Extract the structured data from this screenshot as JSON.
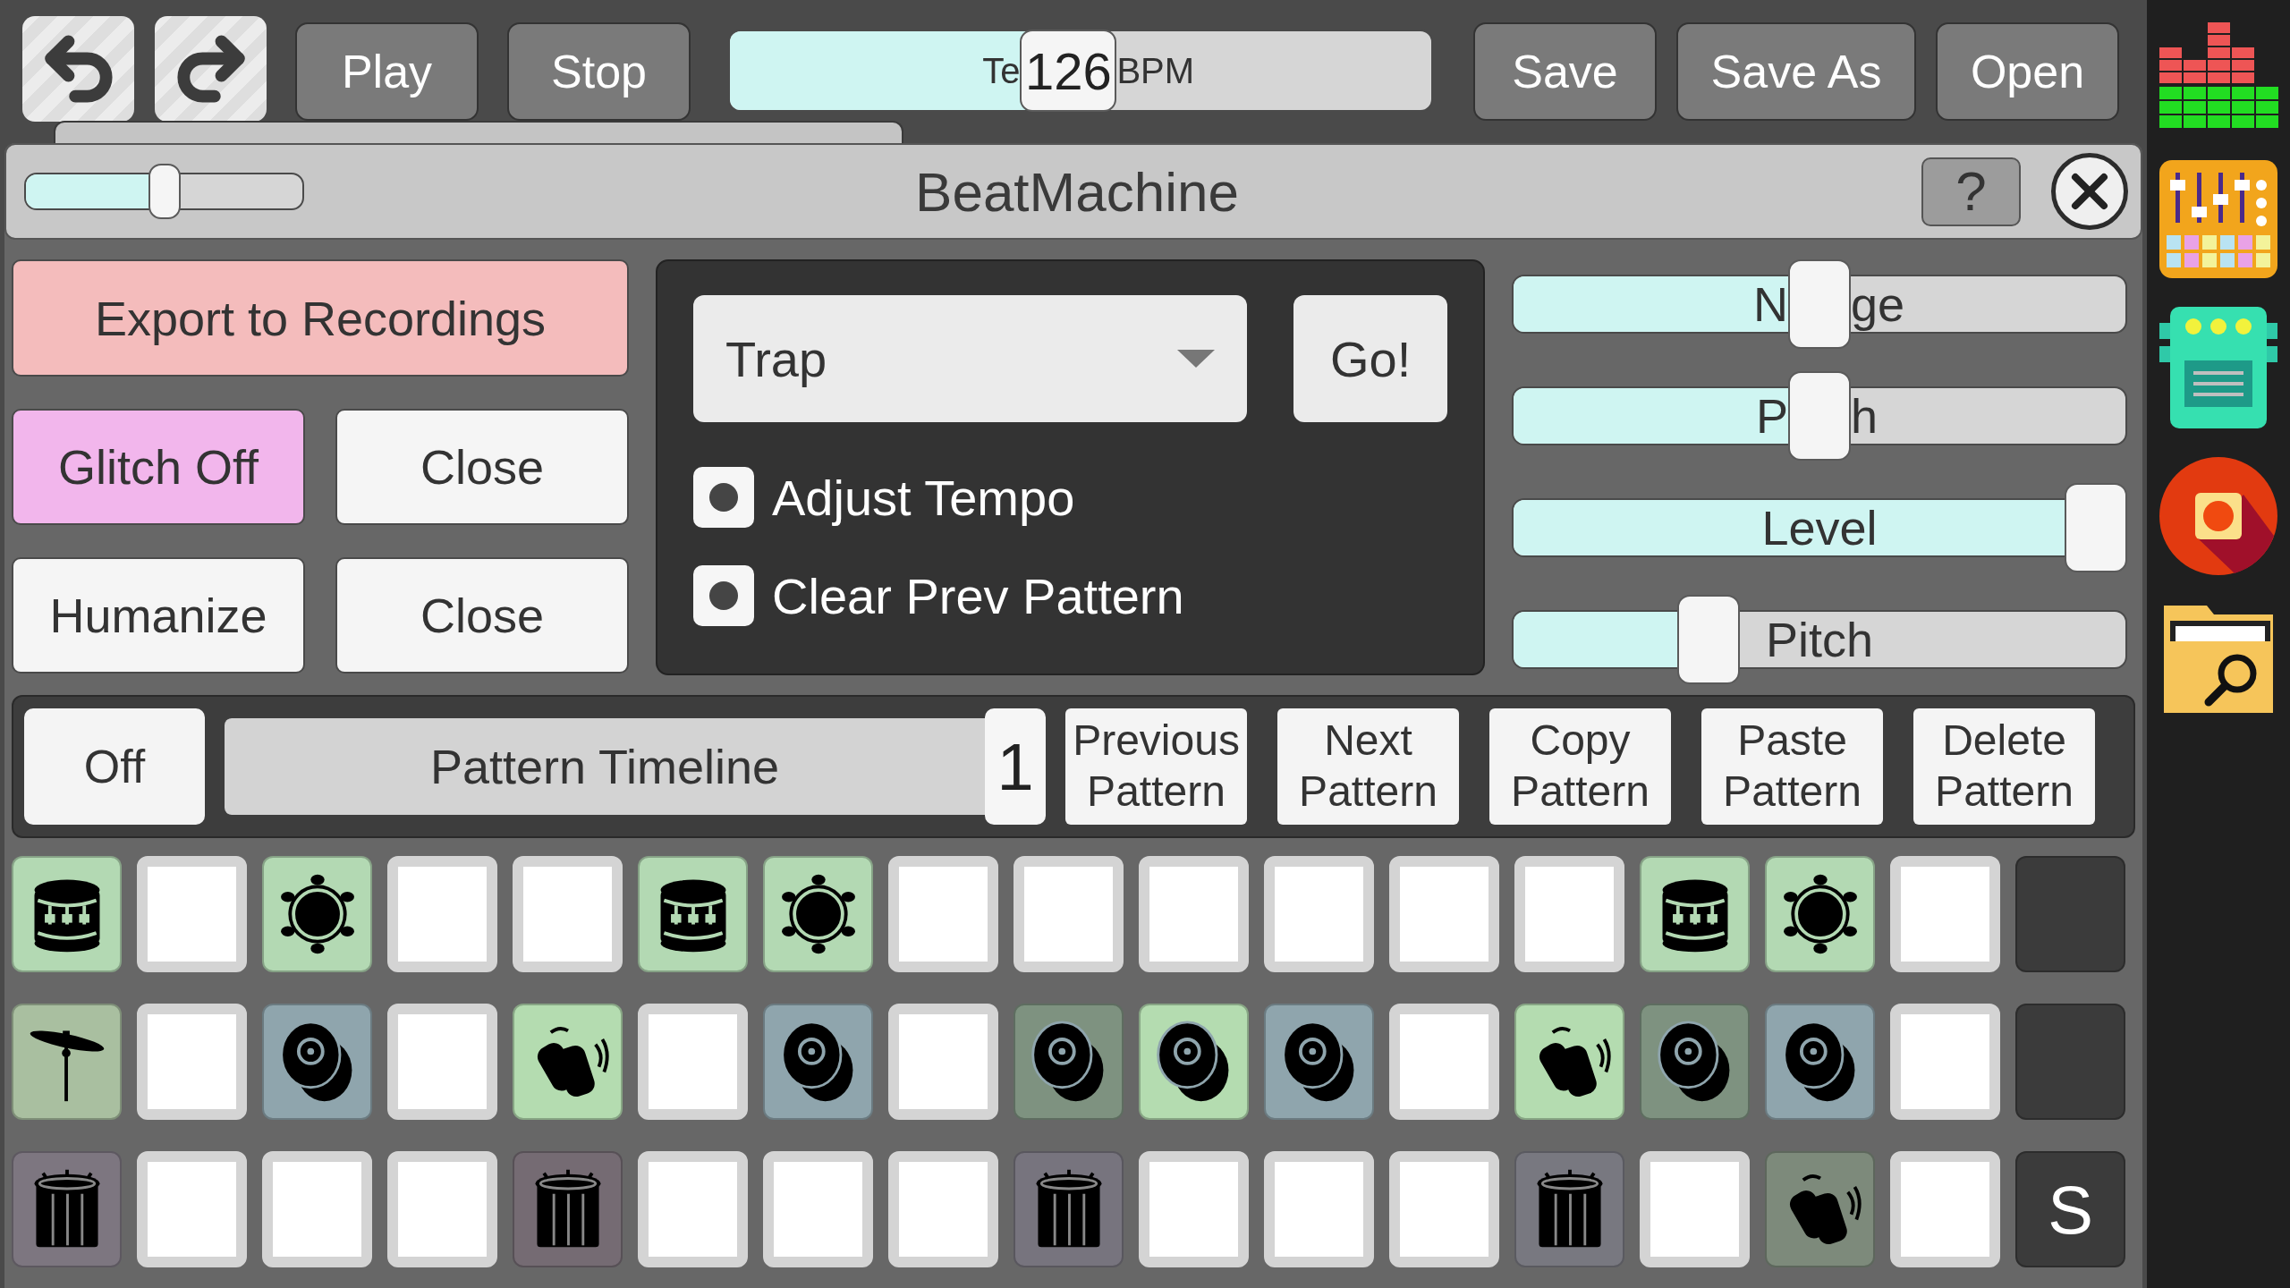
{
  "history_buttons": [
    {
      "kind": "undo"
    },
    {
      "kind": "redo"
    }
  ],
  "transport_buttons": [
    "Play",
    "Stop"
  ],
  "tempo": {
    "label_parts": [
      "Te",
      "BPM"
    ],
    "value": "126",
    "level": 0.48
  },
  "file_buttons": [
    "Save",
    "Save As",
    "Open"
  ],
  "dock": [
    {
      "kind": "meter"
    },
    {
      "kind": "mixer"
    },
    {
      "kind": "machine"
    },
    {
      "kind": "record"
    },
    {
      "kind": "folder"
    }
  ],
  "dialog": {
    "title": "BeatMachine",
    "slider": {
      "level": 0.5
    },
    "help": "?"
  },
  "actions": [
    {
      "label": "Export to Recordings",
      "color": "#f4bcbc"
    },
    {
      "label": "Glitch Off",
      "color": "#f2b6ec"
    },
    {
      "label": "Close",
      "color": "#f5f5f5"
    },
    {
      "label": "Humanize",
      "color": "#f5f5f5"
    },
    {
      "label": "Close",
      "color": "#f5f5f5"
    }
  ],
  "preset": {
    "value": "Trap",
    "go": "Go!"
  },
  "options": [
    {
      "label": "Adjust Tempo",
      "checked": true
    },
    {
      "label": "Clear Prev Pattern",
      "checked": true
    }
  ],
  "sliders": [
    {
      "label_parts": [
        "N",
        "ge"
      ],
      "level": 0.5
    },
    {
      "label_parts": [
        "P",
        "h"
      ],
      "level": 0.5
    },
    {
      "label_parts": [
        "Level"
      ],
      "level": 1
    },
    {
      "label_parts": [
        "Pitch"
      ],
      "level": 0.3
    }
  ],
  "pattern_bar": {
    "toggle": "Off",
    "timeline": "Pattern Timeline",
    "number": "1",
    "buttons": [
      "Previous Pattern",
      "Next Pattern",
      "Copy Pattern",
      "Paste Pattern",
      "Delete Pattern"
    ]
  },
  "grid": [
    [
      {
        "kind": "drum",
        "color": "#b3d9b3"
      },
      {
        "kind": "empty"
      },
      {
        "kind": "tambourine",
        "color": "#b3d9b3"
      },
      {
        "kind": "empty"
      },
      {
        "kind": "empty"
      },
      {
        "kind": "drum",
        "color": "#b3d9b3"
      },
      {
        "kind": "tambourine",
        "color": "#b3d9b3"
      },
      {
        "kind": "empty"
      },
      {
        "kind": "empty"
      },
      {
        "kind": "empty"
      },
      {
        "kind": "empty"
      },
      {
        "kind": "empty"
      },
      {
        "kind": "empty"
      },
      {
        "kind": "drum",
        "color": "#b3d9b3"
      },
      {
        "kind": "tambourine",
        "color": "#b3d9b3"
      },
      {
        "kind": "empty"
      },
      {
        "kind": "end"
      }
    ],
    [
      {
        "kind": "cymbal",
        "color": "#a9bfa0"
      },
      {
        "kind": "empty"
      },
      {
        "kind": "bongo",
        "color": "#8fa5ad"
      },
      {
        "kind": "empty"
      },
      {
        "kind": "clap",
        "color": "#b4dcb0"
      },
      {
        "kind": "empty"
      },
      {
        "kind": "bongo",
        "color": "#8fa5ad"
      },
      {
        "kind": "empty"
      },
      {
        "kind": "bongo",
        "color": "#7e9280"
      },
      {
        "kind": "bongo",
        "color": "#b4dcb0"
      },
      {
        "kind": "bongo",
        "color": "#8fa5ad"
      },
      {
        "kind": "empty"
      },
      {
        "kind": "clap",
        "color": "#b4dcb0"
      },
      {
        "kind": "bongo",
        "color": "#7e9280"
      },
      {
        "kind": "bongo",
        "color": "#8fa5ad"
      },
      {
        "kind": "empty"
      },
      {
        "kind": "end"
      }
    ],
    [
      {
        "kind": "tom",
        "color": "#7d7680"
      },
      {
        "kind": "empty"
      },
      {
        "kind": "empty"
      },
      {
        "kind": "empty"
      },
      {
        "kind": "tom",
        "color": "#756b73"
      },
      {
        "kind": "empty"
      },
      {
        "kind": "empty"
      },
      {
        "kind": "empty"
      },
      {
        "kind": "tom",
        "color": "#77747e"
      },
      {
        "kind": "empty"
      },
      {
        "kind": "empty"
      },
      {
        "kind": "empty"
      },
      {
        "kind": "tom",
        "color": "#787880"
      },
      {
        "kind": "empty"
      },
      {
        "kind": "clap",
        "color": "#7d8a7b"
      },
      {
        "kind": "empty"
      },
      {
        "kind": "end",
        "label": "S"
      }
    ]
  ]
}
